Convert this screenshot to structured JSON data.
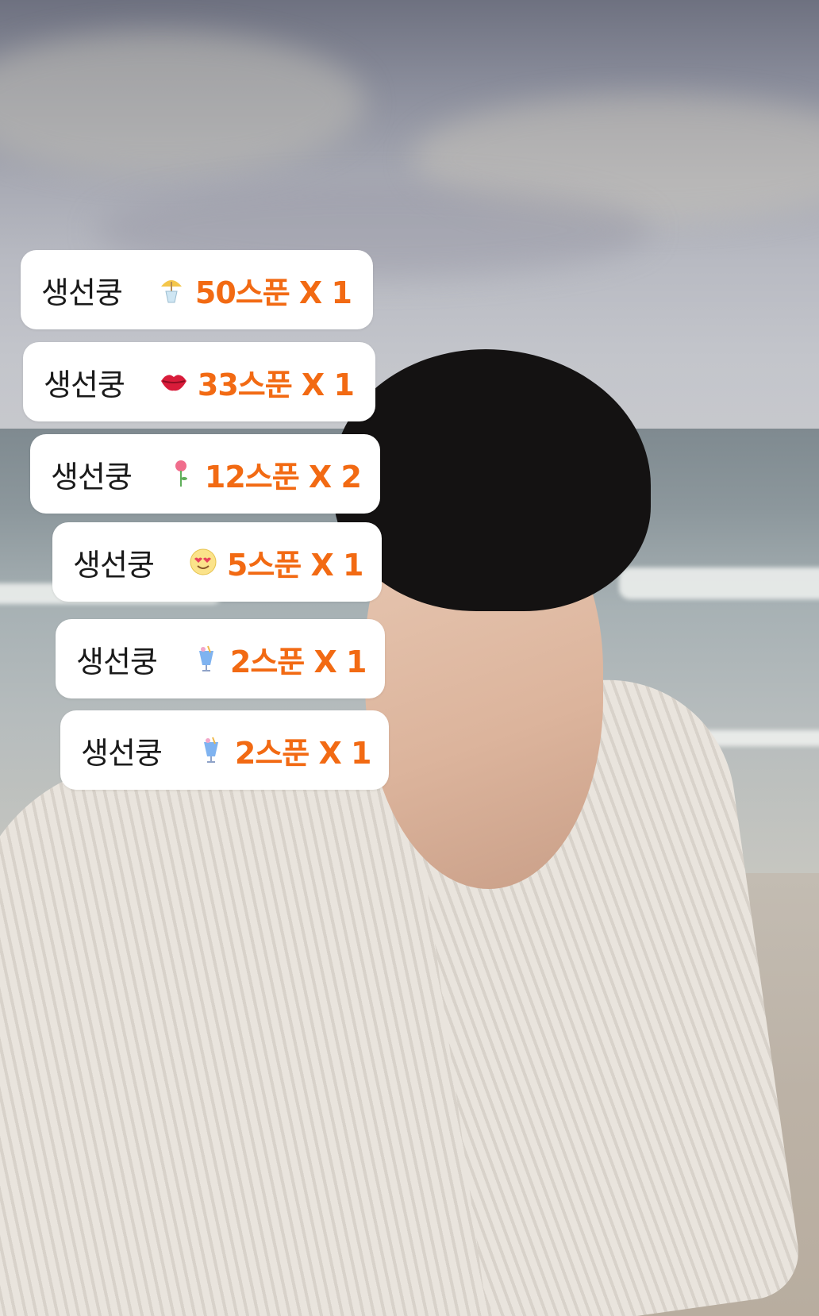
{
  "stickers": [
    {
      "name": "생선쿵",
      "icon": "cocktail-umbrella-icon",
      "amount": "50스푼 X 1"
    },
    {
      "name": "생선쿵",
      "icon": "lips-icon",
      "amount": "33스푼 X 1"
    },
    {
      "name": "생선쿵",
      "icon": "rose-icon",
      "amount": "12스푼 X 2"
    },
    {
      "name": "생선쿵",
      "icon": "heart-eyes-face-icon",
      "amount": "5스푼 X 1"
    },
    {
      "name": "생선쿵",
      "icon": "tropical-drink-icon",
      "amount": "2스푼 X 1"
    },
    {
      "name": "생선쿵",
      "icon": "tropical-drink-icon",
      "amount": "2스푼 X 1"
    }
  ],
  "colors": {
    "amount": "#f26a13",
    "name": "#1a1a1a",
    "sticker_bg": "#ffffff"
  }
}
